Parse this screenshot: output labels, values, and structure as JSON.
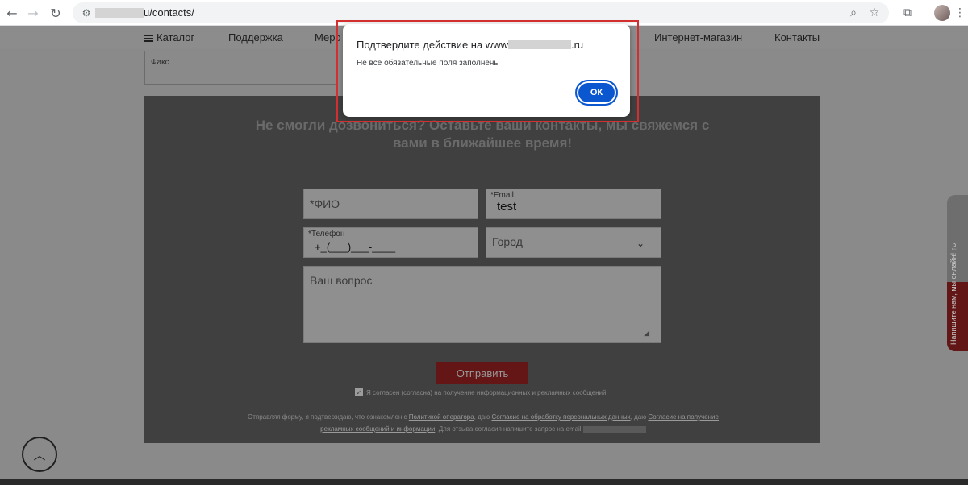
{
  "browser": {
    "url_visible": "u/contacts/",
    "icons": [
      "back-arrow-icon",
      "forward-arrow-icon",
      "reload-icon",
      "site-settings-icon",
      "zoom-icon",
      "bookmark-star-icon",
      "extensions-icon",
      "profile-avatar"
    ]
  },
  "site_nav": {
    "items": [
      "Каталог",
      "Поддержка",
      "Меро",
      "Интернет-магазин",
      "Контакты"
    ]
  },
  "fax_label": "Факс",
  "form": {
    "title_line1": "Не смогли дозвониться? Оставьте ваши контакты, мы свяжемся с",
    "title_line2": "вами в ближайшее время!",
    "fio_placeholder": "*ФИО",
    "email_label": "*Email",
    "email_value": "test",
    "phone_label": "*Телефон",
    "phone_mask": "+_(___)___-____",
    "city_placeholder": "Город",
    "question_placeholder": "Ваш вопрос",
    "submit_label": "Отправить",
    "consent_text": "Я согласен (согласна) на получение информационных и рекламных сообщений",
    "policy_prefix": "Отправляя форму, я подтверждаю, что ознакомлен с ",
    "policy_link1": "Политикой оператора",
    "policy_mid1": ", даю ",
    "policy_link2": "Согласие на обработку персональных данных",
    "policy_mid2": ", даю ",
    "policy_link3": "Согласие на получение рекламных сообщений и информации",
    "policy_suffix": ". Для отзыва согласия напишите запрос на email"
  },
  "side_widget_text": "Напишите нам, мы онлайн! ↑ᴗ",
  "dialog": {
    "title_prefix": "Подтвердите действие на www",
    "title_suffix": ".ru",
    "message": "Не все обязательные поля заполнены",
    "ok_label": "ОК"
  },
  "colors": {
    "dialog_button": "#0b57d0",
    "highlight_border": "#d32f2f",
    "panel_bg": "#404040"
  }
}
